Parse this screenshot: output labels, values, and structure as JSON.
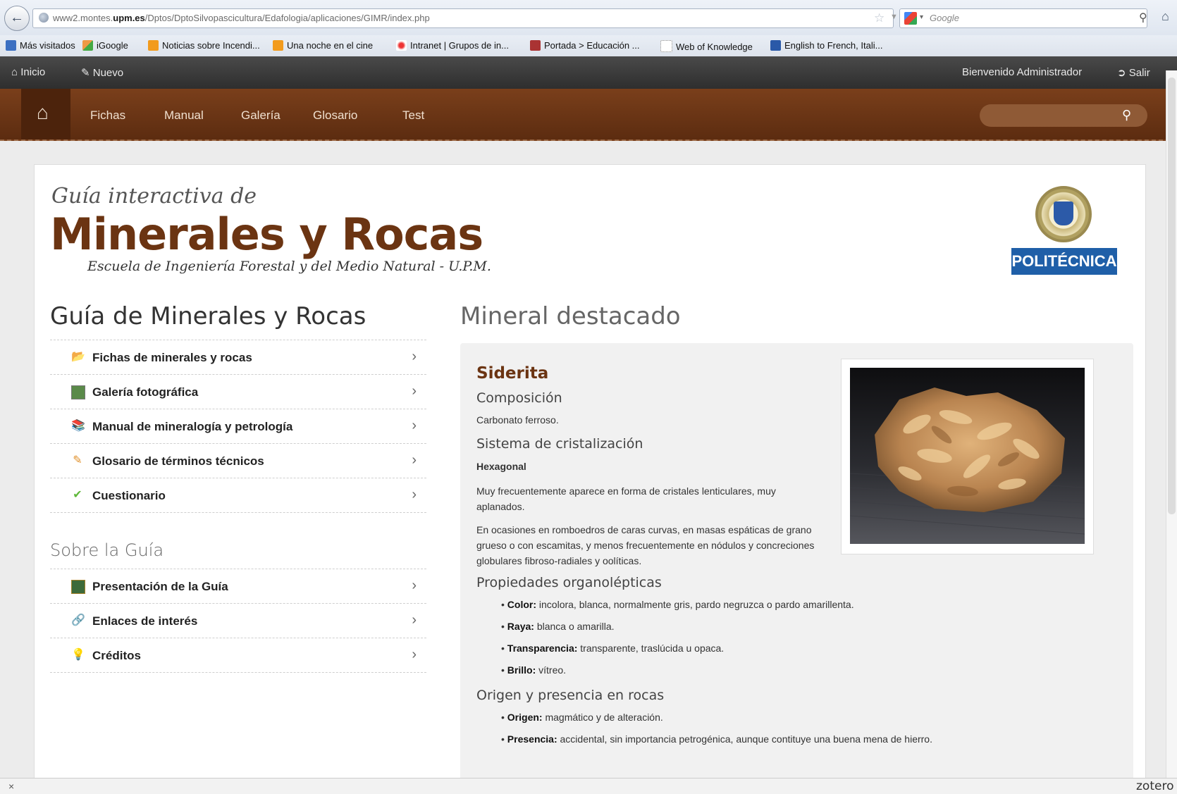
{
  "browser": {
    "url_prefix": "www2.montes.",
    "url_domain": "upm.es",
    "url_path": "/Dptos/DptoSilvopascicultura/Edafologia/aplicaciones/GIMR/index.php",
    "search_placeholder": "Google",
    "bookmarks": [
      {
        "label": "Más visitados",
        "icon_color": "#3b6fc2"
      },
      {
        "label": "iGoogle",
        "icon_color": "#e0a020"
      },
      {
        "label": "Noticias sobre Incendi...",
        "icon_color": "#f29b1d"
      },
      {
        "label": "Una noche en el cine",
        "icon_color": "#f29b1d"
      },
      {
        "label": "Intranet | Grupos de in...",
        "icon_color": "#d33"
      },
      {
        "label": "Portada > Educación ...",
        "icon_color": "#a33"
      },
      {
        "label": "Web of Knowledge",
        "icon_color": "#ffffff"
      },
      {
        "label": "English to French, Itali...",
        "icon_color": "#2a59a8"
      }
    ],
    "status_close": "×",
    "zotero": "zotero"
  },
  "topbar": {
    "inicio": "Inicio",
    "nuevo": "Nuevo",
    "welcome": "Bienvenido Administrador",
    "salir": "Salir"
  },
  "nav": {
    "items": [
      "Fichas",
      "Manual",
      "Galería",
      "Glosario",
      "Test"
    ]
  },
  "header": {
    "script_title": "Guía interactiva de",
    "main_title": "Minerales y Rocas",
    "subtitle": "Escuela de Ingeniería Forestal y del Medio Natural - U.P.M.",
    "upm_label": "POLITÉCNICA"
  },
  "left": {
    "title": "Guía de Minerales y Rocas",
    "menu": [
      {
        "label": "Fichas de minerales y rocas",
        "icon": "folder-icon"
      },
      {
        "label": "Galería fotográfica",
        "icon": "picture-icon"
      },
      {
        "label": "Manual de mineralogía y petrología",
        "icon": "books-icon"
      },
      {
        "label": "Glosario de términos técnicos",
        "icon": "pencil-icon"
      },
      {
        "label": "Cuestionario",
        "icon": "checkmark-icon"
      }
    ],
    "about_title": "Sobre la Guía",
    "about_menu": [
      {
        "label": "Presentación de la Guía",
        "icon": "presentation-icon"
      },
      {
        "label": "Enlaces de interés",
        "icon": "link-icon"
      },
      {
        "label": "Créditos",
        "icon": "lightbulb-icon"
      }
    ]
  },
  "featured": {
    "title": "Mineral destacado",
    "name": "Siderita",
    "composition_title": "Composición",
    "composition": "Carbonato ferroso.",
    "crystal_title": "Sistema de cristalización",
    "crystal_value": "Hexagonal",
    "crystal_desc1": "Muy frecuentemente aparece en forma de cristales lenticulares, muy aplanados.",
    "crystal_desc2": "En ocasiones en romboedros de caras curvas, en masas espáticas de grano grueso o con escamitas, y menos frecuentemente en nódulos y concreciones globulares fibroso-radiales y oolíticas.",
    "props_title": "Propiedades organolépticas",
    "props": [
      {
        "key": "Color:",
        "value": "incolora, blanca, normalmente gris, pardo negruzca o pardo amarillenta."
      },
      {
        "key": "Raya:",
        "value": "blanca o amarilla."
      },
      {
        "key": "Transparencia:",
        "value": "transparente, traslúcida u opaca."
      },
      {
        "key": "Brillo:",
        "value": "vítreo."
      }
    ],
    "origin_title": "Origen y presencia en rocas",
    "origin": [
      {
        "key": "Origen:",
        "value": "magmático y de alteración."
      },
      {
        "key": "Presencia:",
        "value": "accidental, sin importancia petrogénica, aunque contituye una buena mena de hierro."
      }
    ]
  }
}
